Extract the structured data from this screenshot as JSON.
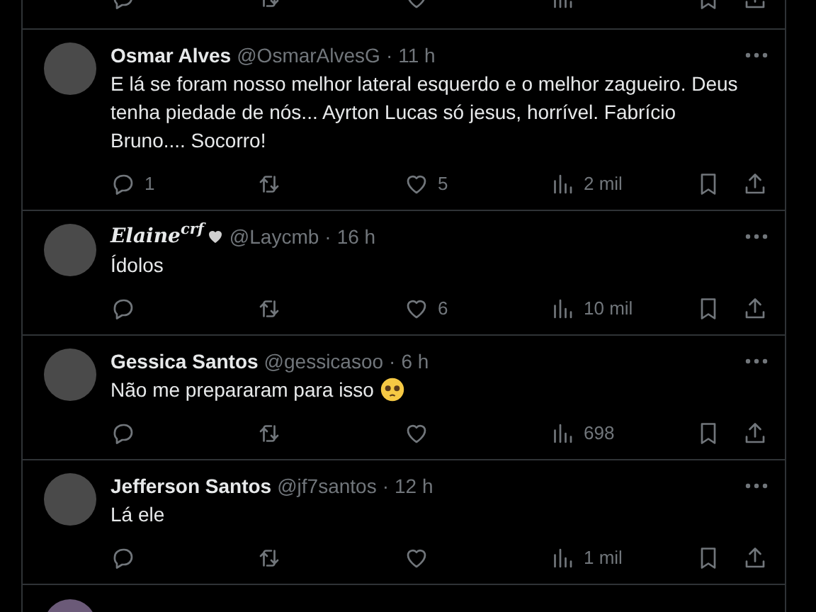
{
  "previous_tweet_cut_off": true,
  "tweets": [
    {
      "kind": "plain",
      "name": "Osmar Alves",
      "handle": "@OsmarAlvesG",
      "separator": "·",
      "time": "11 h",
      "text": "E lá se foram nosso melhor lateral esquerdo e o melhor zagueiro. Deus tenha piedade de nós... Ayrton Lucas só jesus, horrível. Fabrício Bruno.... Socorro!",
      "trailing_emoji": false,
      "reply_count": "1",
      "like_count": "5",
      "view_count": "2 mil"
    },
    {
      "kind": "fancy",
      "name": "Elaine$^{crf}$",
      "handle": "@Laycmb",
      "separator": "·",
      "time": "16 h",
      "text": "Ídolos",
      "trailing_emoji": false,
      "like_count": "6",
      "view_count": "10 mil"
    },
    {
      "kind": "plain",
      "name": "Gessica Santos",
      "handle": "@gessicasoo",
      "separator": "·",
      "time": "6 h",
      "text": "Não me prepararam para isso",
      "trailing_emoji": true,
      "view_count": "698"
    },
    {
      "kind": "plain",
      "name": "Jefferson Santos",
      "handle": "@jf7santos",
      "separator": "·",
      "time": "12 h",
      "text": "Lá ele",
      "trailing_emoji": false,
      "view_count": "1 mil"
    }
  ],
  "next_tweet_cut_off": true
}
